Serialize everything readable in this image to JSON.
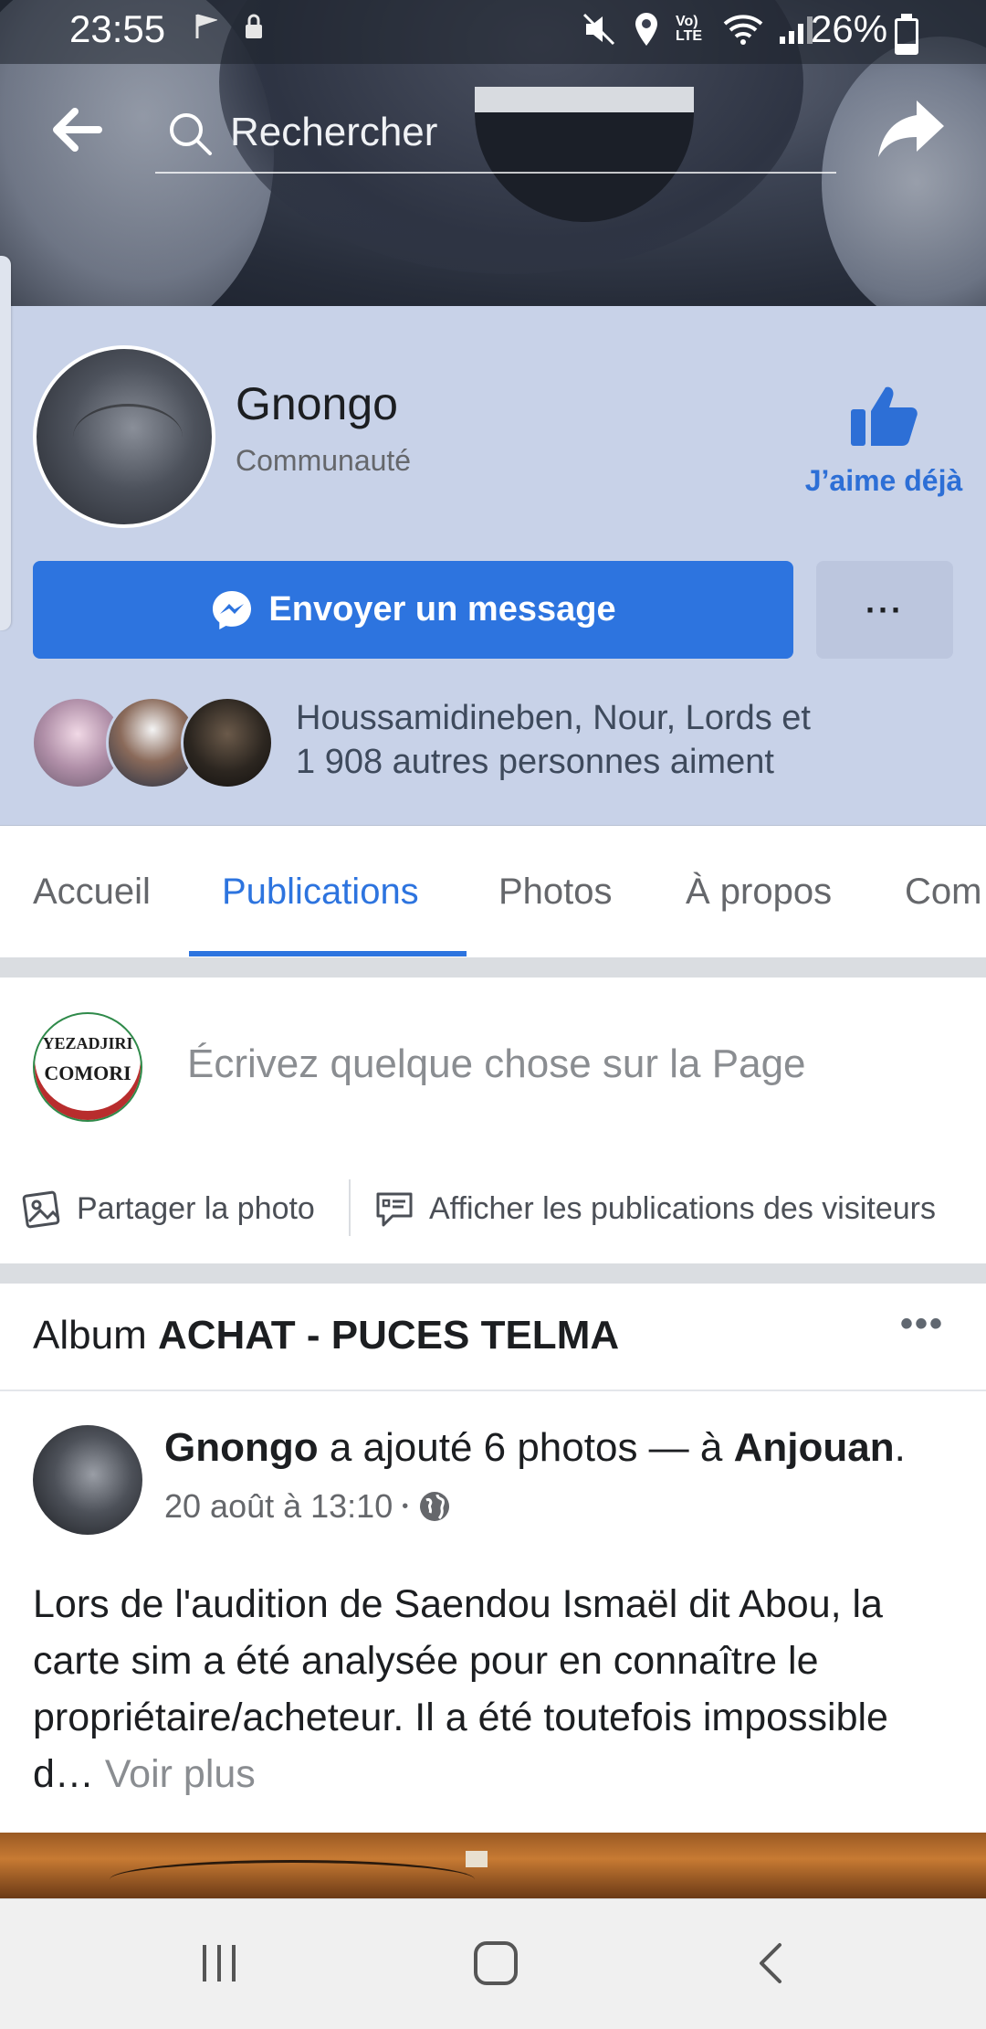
{
  "status_bar": {
    "time": "23:55",
    "network_label": "Vo) LTE",
    "battery_percent": "26%",
    "battery_level": 0.26
  },
  "top_bar": {
    "search_placeholder": "Rechercher"
  },
  "page": {
    "name": "Gnongo",
    "category": "Communauté",
    "like_label": "J’aime déjà",
    "message_button": "Envoyer un message",
    "more_button": "···",
    "likes_line1": "Houssamidineben, Nour, Lords et",
    "likes_line2": "1 908 autres personnes aiment"
  },
  "tabs": [
    {
      "label": "Accueil",
      "active": false
    },
    {
      "label": "Publications",
      "active": true
    },
    {
      "label": "Photos",
      "active": false
    },
    {
      "label": "À propos",
      "active": false
    },
    {
      "label": "Com",
      "active": false
    }
  ],
  "composer": {
    "avatar_line1": "YEZADJIRI",
    "avatar_line2": "COMORI",
    "placeholder": "Écrivez quelque chose sur la Page",
    "share_photo": "Partager la photo",
    "visitor_posts": "Afficher les publications des visiteurs"
  },
  "album": {
    "prefix": "Album",
    "name": "ACHAT - PUCES TELMA",
    "more": "•••"
  },
  "post": {
    "author": "Gnongo",
    "action": " a ajouté 6 photos — à ",
    "location": "Anjouan",
    "suffix": ".",
    "date": "20 août à 13:10",
    "dot": "•",
    "body": "Lors de l'audition de Saendou Ismaël dit Abou, la carte sim a été analysée pour en connaître le propriétaire/acheteur. Il a été toutefois impossible d…",
    "see_more": "Voir plus"
  },
  "colors": {
    "accent": "#2d74df",
    "header_bg": "#c8d2e8",
    "separator": "#dadde1"
  }
}
